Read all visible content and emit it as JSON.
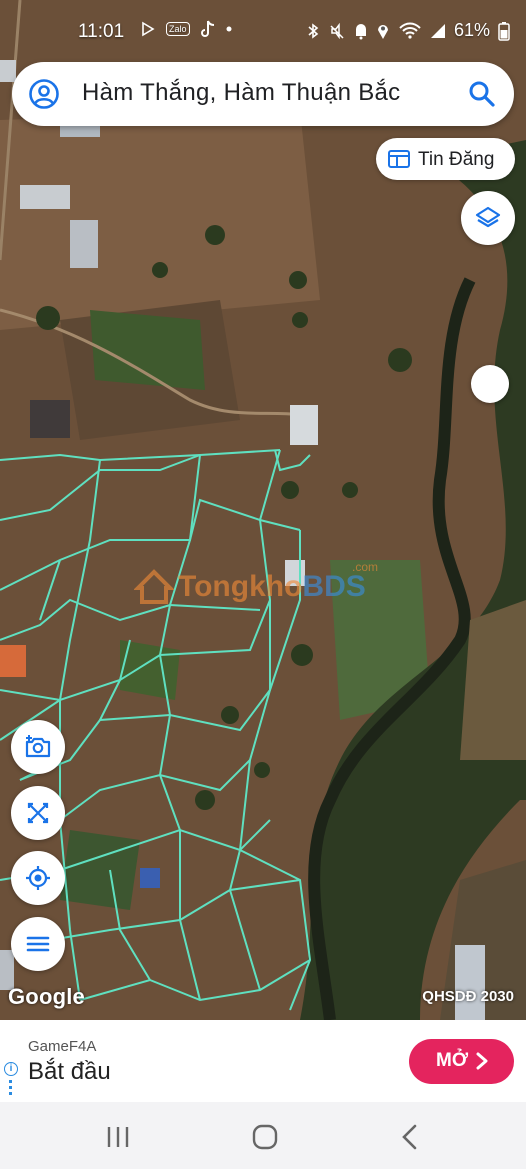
{
  "status_bar": {
    "time": "11:01",
    "apps": [
      "Zalo"
    ],
    "battery": "61%"
  },
  "search": {
    "query": "Hàm Thắng, Hàm Thuận Bắc",
    "icon_user": "account-icon",
    "icon_search": "search-icon"
  },
  "listing_button": {
    "label": "Tin Đăng",
    "icon": "listing-icon"
  },
  "map": {
    "watermark_tongkho": "Tongkho",
    "watermark_bds": "BDS",
    "watermark_com": ".com",
    "provider": "Google",
    "plan_label": "QHSDĐ 2030",
    "parcel_color": "#5fe0c0"
  },
  "side_buttons": [
    "camera-icon",
    "measure-icon",
    "location-icon",
    "menu-icon"
  ],
  "ad": {
    "advertiser": "GameF4A",
    "headline": "Bắt đầu",
    "cta": "MỞ",
    "info_glyph": "i",
    "accent_color": "#e4245e"
  },
  "nav_bar": [
    "recent-apps-icon",
    "home-icon",
    "back-icon"
  ]
}
